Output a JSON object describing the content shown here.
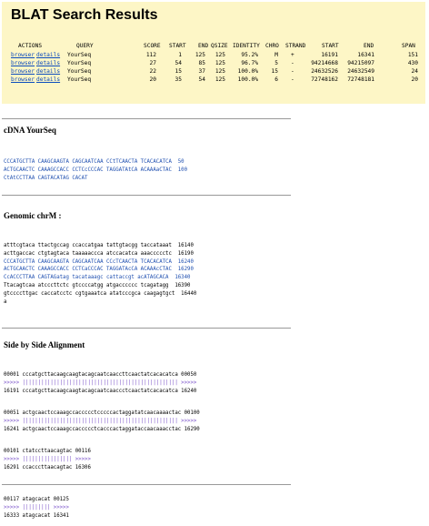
{
  "header": {
    "title": "BLAT Search Results",
    "columns": [
      "ACTIONS",
      "QUERY",
      "SCORE",
      "START",
      "END",
      "QSIZE",
      "IDENTITY",
      "CHRO",
      "STRAND",
      "START",
      "END",
      "SPAN"
    ],
    "rows": [
      {
        "browser": "browser",
        "details": "details",
        "query": "YourSeq",
        "score": "112",
        "start": "1",
        "end": "125",
        "qsize": "125",
        "identity": "95.2%",
        "chro": "M",
        "strand": "+",
        "tstart": "16191",
        "tend": "16341",
        "span": "151"
      },
      {
        "browser": "browser",
        "details": "details",
        "query": "YourSeq",
        "score": "27",
        "start": "54",
        "end": "85",
        "qsize": "125",
        "identity": "96.7%",
        "chro": "5",
        "strand": "-",
        "tstart": "94214668",
        "tend": "94215097",
        "span": "430"
      },
      {
        "browser": "browser",
        "details": "details",
        "query": "YourSeq",
        "score": "22",
        "start": "15",
        "end": "37",
        "qsize": "125",
        "identity": "100.0%",
        "chro": "15",
        "strand": "-",
        "tstart": "24632526",
        "tend": "24632549",
        "span": "24"
      },
      {
        "browser": "browser",
        "details": "details",
        "query": "YourSeq",
        "score": "20",
        "start": "35",
        "end": "54",
        "qsize": "125",
        "identity": "100.0%",
        "chro": "6",
        "strand": "-",
        "tstart": "72748162",
        "tend": "72748181",
        "span": "20"
      }
    ]
  },
  "cdna": {
    "title": "cDNA YourSeq",
    "lines": [
      "CCCATGCTTA CAAGCAAGTA CAGCAATCAA CCtTCAACTA TCACACATCA  50",
      "ACTGCAACTC CAAAGCCACC CCTCcCCCAC TAGGATAtCA ACAAAaCTAC  100",
      "CtAtCCTTAA CAGTACATAG CACAT"
    ]
  },
  "genomic": {
    "title": "Genomic chrM :",
    "lines": [
      "atttcgtaca ttactgccag ccaccatgaa tattgtacgg taccataaat  16140",
      "acttgaccac ctgtagtaca taaaaaccca atccacatca aaaccccctc  16190",
      "CCCATGCTTA CAAGCAAGTA CAGCAATCAA CCcTCAACTA TCACACATCA  16240",
      "ACTGCAACTC CAAAGCCACC CCTCaCCCAC TAGGATAcCA ACAAAcCTAC  16290",
      "CcACCCTTAA CAGTAGatag tacataaagc cattaccgt acATAGCACA  16340",
      "Ttacagtcaa atcccttctc gtccccatgg atgacccccc tcagatagg  16390",
      "gtccccttgac caccatcctc cgtgaaatca atatcccgca caagagtgct  16440",
      "a"
    ]
  },
  "side": {
    "title": "Side by Side Alignment",
    "blocks": [
      {
        "q": "00001 cccatgcttacaagcaagtacagcaatcaaccttcaactatcacacatca 00050",
        "m": ">>>>> |||||||||||||||||||||||||||||||||||||||||||||||||| >>>>>",
        "t": "16191 cccatgcttacaagcaagtacagcaatcaaccctcaactatcacacatca 16240"
      },
      {
        "q": "00051 actgcaactccaaagccaccccctcccccactaggatatcaacaaaactac 00100",
        "m": ">>>>> |||||||||||||||||||||||||||||||||||||||||||||||||| >>>>>",
        "t": "16241 actgcaactccaaagccaccccctcacccactaggataccaacaaacctac 16290"
      },
      {
        "q": "00101 ctatccttaacagtac 00116",
        "m": ">>>>> |||||||||||||||| >>>>>",
        "t": "16291 ccacccttaacagtac 16306"
      },
      {
        "q": "00117 atagcacat 00125",
        "m": ">>>>> ||||||||| >>>>>",
        "t": "16333 atagcacat 16341"
      }
    ]
  }
}
